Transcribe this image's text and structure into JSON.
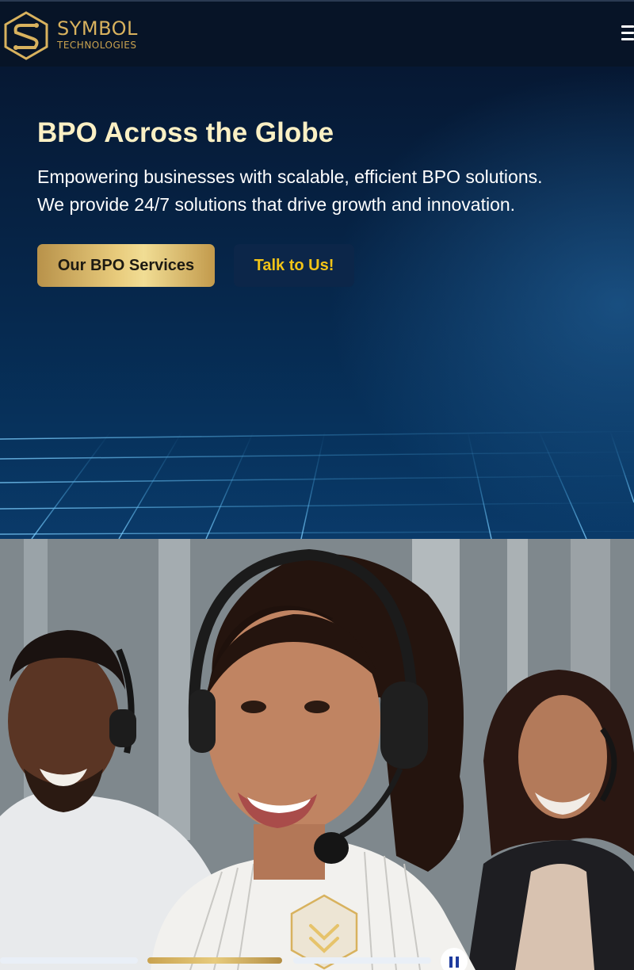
{
  "header": {
    "brand_name": "SYMBOL",
    "brand_sub": "TECHNOLOGIES",
    "logo_icon": "symbol-logo-mark",
    "menu_icon": "hamburger-menu-icon"
  },
  "hero": {
    "title": "BPO Across the Globe",
    "subtitle_line1": "Empowering businesses with scalable, efficient BPO solutions.",
    "subtitle_line2": "We provide 24/7 solutions that drive growth and innovation.",
    "primary_button": "Our BPO Services",
    "secondary_button": "Talk to Us!"
  },
  "carousel": {
    "scroll_icon": "chevron-double-down-icon",
    "pause_icon": "pause-icon",
    "slides_total": 3,
    "active_slide": 2
  },
  "colors": {
    "gold": "#d8b25e",
    "title_cream": "#fbf0c4",
    "talk_text": "#f2c417",
    "navy": "#071427"
  }
}
